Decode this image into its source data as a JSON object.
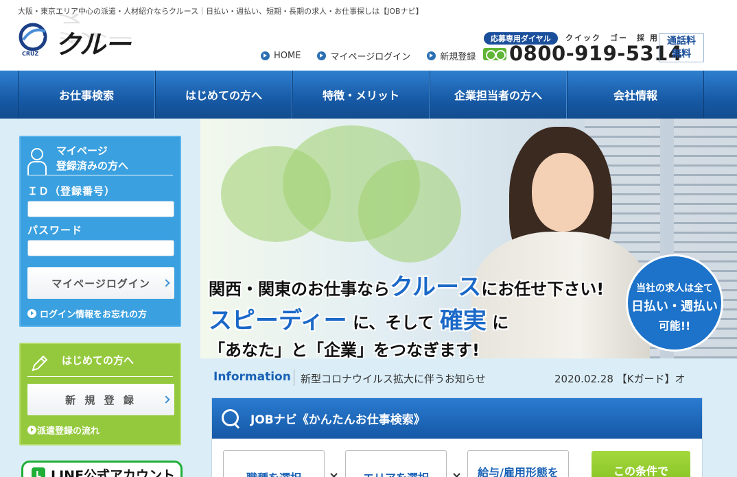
{
  "header": {
    "tagline": "大阪・東京エリア中心の派遣・人材紹介ならクルース｜日払い・週払い、短期・長期の求人・お仕事探しは【JOBナビ】",
    "logo_text": "クルース",
    "logo_sub": "CRUZ",
    "links": [
      {
        "label": "HOME"
      },
      {
        "label": "マイページログイン"
      },
      {
        "label": "新規登録"
      }
    ],
    "dial_badge": "応募専用ダイヤル",
    "dial_kana": "クイック　ゴー　採 用",
    "phone": "0800-919-5314",
    "free_line1": "通話料",
    "free_line2": "無料"
  },
  "nav": {
    "items": [
      {
        "label": "お仕事検索"
      },
      {
        "label": "はじめての方へ"
      },
      {
        "label": "特徴・メリット"
      },
      {
        "label": "企業担当者の方へ"
      },
      {
        "label": "会社情報"
      }
    ]
  },
  "hero": {
    "line1_a": "関西・関東のお仕事なら",
    "line1_b": "クルース",
    "line1_c": "にお任せ下さい!",
    "line2_a": "スピーディー",
    "line2_b": "に、そして",
    "line2_c": "確実",
    "line2_d": "に",
    "line3": "「あなた」と「企業」をつなぎます!",
    "circle_1": "当社の求人は全て",
    "circle_2": "日払い・週払い",
    "circle_3": "可能!!"
  },
  "login": {
    "title_1": "マイページ",
    "title_2": "登録済みの方へ",
    "id_label": "ＩＤ（登録番号）",
    "password_label": "パスワード",
    "button": "マイページログイン",
    "forgot": "ログイン情報をお忘れの方"
  },
  "first": {
    "title": "はじめての方へ",
    "button": "新 規 登 録",
    "flow": "派遣登録の流れ"
  },
  "line": {
    "text": "LINE公式アカウント",
    "icon": "L"
  },
  "info": {
    "label": "Information",
    "text": "新型コロナウイルス拡大に伴うお知らせ",
    "date": "2020.02.28 【Kガード】オ"
  },
  "search": {
    "title": "JOBナビ《かんたんお仕事検索》",
    "select_1": "職種を選択",
    "select_2": "エリアを選択",
    "select_3": "給与/雇用形態を",
    "sep": "×",
    "go": "この条件で"
  },
  "colors": {
    "brand_blue": "#1b4f9c",
    "nav_blue": "#175aa6",
    "login_panel": "#3aa0e0",
    "first_panel": "#95c93d",
    "line_green": "#1fae36"
  }
}
